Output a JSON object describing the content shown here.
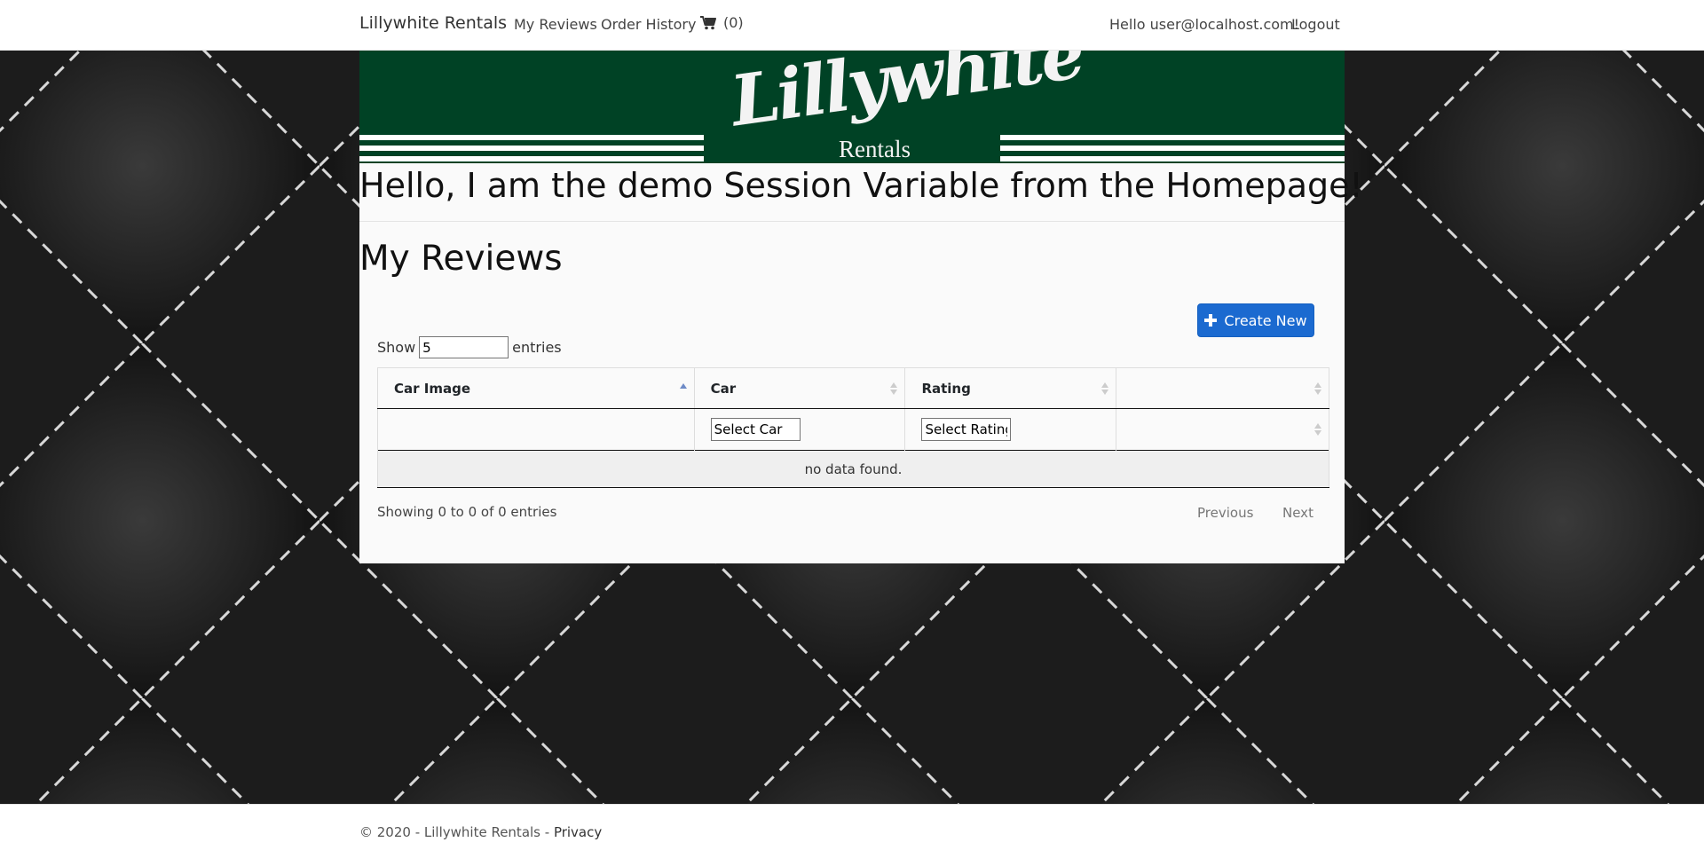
{
  "navbar": {
    "brand": "Lillywhite Rentals",
    "links": [
      "My Reviews",
      "Order History"
    ],
    "cart_count": "(0)",
    "greeting": "Hello user@localhost.com!",
    "logout": "Logout"
  },
  "banner": {
    "logo_script": "Lillywhite",
    "logo_sub": "Rentals",
    "bg_color": "#004225"
  },
  "session_message": "Hello, I am the demo Session Variable from the Homepage!",
  "page_title": "My Reviews",
  "create_button": "Create New",
  "table_controls": {
    "show_label": "Show",
    "entries_value": "5",
    "entries_label": "entries"
  },
  "table": {
    "columns": [
      "Car Image",
      "Car",
      "Rating",
      ""
    ],
    "filters": {
      "car_placeholder": "Select Car",
      "rating_placeholder": "Select Rating"
    },
    "empty_message": "no data found."
  },
  "table_info": "Showing 0 to 0 of 0 entries",
  "pagination": {
    "previous": "Previous",
    "next": "Next"
  },
  "footer": {
    "copyright": "© 2020 - Lillywhite Rentals - ",
    "privacy": "Privacy"
  },
  "colors": {
    "accent": "#1b6ad0",
    "banner": "#004225",
    "background": "#151515"
  },
  "icons": [
    "cart-icon",
    "plus-icon",
    "sort-icon"
  ]
}
